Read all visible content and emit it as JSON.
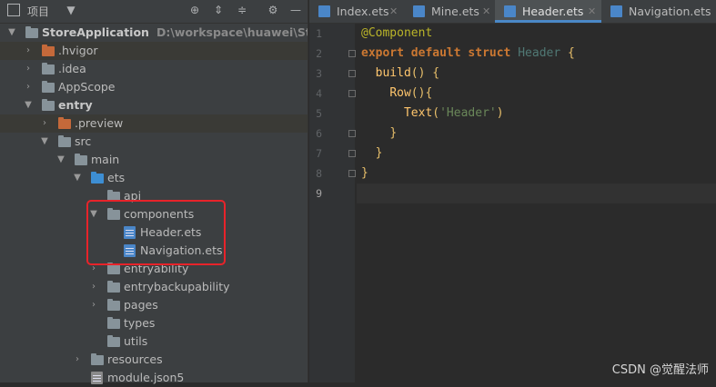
{
  "project_panel": {
    "title": "项目",
    "tree": [
      {
        "label": "StoreApplication",
        "path": "D:\\workspace\\huawei\\StoreApp",
        "bold": true
      },
      {
        "label": ".hvigor"
      },
      {
        "label": ".idea"
      },
      {
        "label": "AppScope"
      },
      {
        "label": "entry",
        "bold": true
      },
      {
        "label": ".preview"
      },
      {
        "label": "src"
      },
      {
        "label": "main"
      },
      {
        "label": "ets"
      },
      {
        "label": "api"
      },
      {
        "label": "components"
      },
      {
        "label": "Header.ets"
      },
      {
        "label": "Navigation.ets"
      },
      {
        "label": "entryability"
      },
      {
        "label": "entrybackupability"
      },
      {
        "label": "pages"
      },
      {
        "label": "types"
      },
      {
        "label": "utils"
      },
      {
        "label": "resources"
      },
      {
        "label": "module.json5"
      }
    ]
  },
  "editor": {
    "tabs": [
      {
        "label": "Index.ets",
        "active": false
      },
      {
        "label": "Mine.ets",
        "active": false
      },
      {
        "label": "Header.ets",
        "active": true
      },
      {
        "label": "Navigation.ets",
        "active": false
      }
    ],
    "line_numbers": [
      "1",
      "2",
      "3",
      "4",
      "5",
      "6",
      "7",
      "8",
      "9"
    ],
    "code": {
      "l1_annotation": "@Component",
      "l2_export": "export",
      "l2_default": "default",
      "l2_struct": "struct",
      "l2_name": "Header",
      "l2_brace": "{",
      "l3_fn": "build",
      "l3_rest": "() {",
      "l4_fn": "Row",
      "l4_rest": "(){",
      "l5_fn": "Text",
      "l5_open": "(",
      "l5_str": "'Header'",
      "l5_close": ")",
      "l6": "}",
      "l7": "}",
      "l8": "}"
    }
  },
  "watermark": "CSDN @觉醒法师",
  "colors": {
    "accent": "#4a88c7",
    "highlight_box": "#e8232a"
  }
}
